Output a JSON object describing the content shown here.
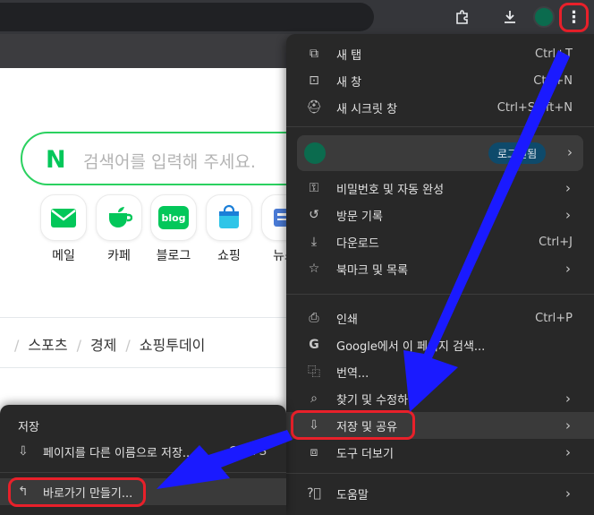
{
  "browser": {
    "icons": {
      "extensions": "puzzle-icon",
      "download": "download-icon",
      "menu": "kebab-menu-icon"
    },
    "colors": {
      "toolbar": "#35363a",
      "accent_red": "#e8202a",
      "arrow_blue": "#1a1aff"
    }
  },
  "page": {
    "search_placeholder": "검색어를 입력해 주세요.",
    "shortcuts": [
      {
        "label": "메일"
      },
      {
        "label": "카페"
      },
      {
        "label": "블로그"
      },
      {
        "label": "쇼핑"
      },
      {
        "label": "뉴스"
      }
    ],
    "blog_badge": "blog",
    "news_nav": [
      "스포츠",
      "경제",
      "쇼핑투데이"
    ]
  },
  "menu": {
    "items": [
      {
        "label": "새 탭",
        "shortcut": "Ctrl+T"
      },
      {
        "label": "새 창",
        "shortcut": "Ctrl+N"
      },
      {
        "label": "새 시크릿 창",
        "shortcut": "Ctrl+Shift+N"
      }
    ],
    "profile_pill": "로그인됨",
    "items2": [
      {
        "label": "비밀번호 및 자동 완성"
      },
      {
        "label": "방문 기록"
      },
      {
        "label": "다운로드",
        "shortcut": "Ctrl+J"
      },
      {
        "label": "북마크 및 목록"
      }
    ],
    "items3": [
      {
        "label": "인쇄",
        "shortcut": "Ctrl+P"
      },
      {
        "label": "Google에서 이 페이지 검색..."
      },
      {
        "label": "번역..."
      },
      {
        "label": "찾기 및 수정하기"
      },
      {
        "label": "저장 및 공유"
      },
      {
        "label": "도구 더보기"
      }
    ],
    "help": {
      "label": "도움말"
    }
  },
  "submenu": {
    "title": "저장",
    "save_as": {
      "label": "페이지를 다른 이름으로 저장...",
      "shortcut": "Ctrl+S"
    },
    "create_shortcut": {
      "label": "바로가기 만들기..."
    }
  }
}
